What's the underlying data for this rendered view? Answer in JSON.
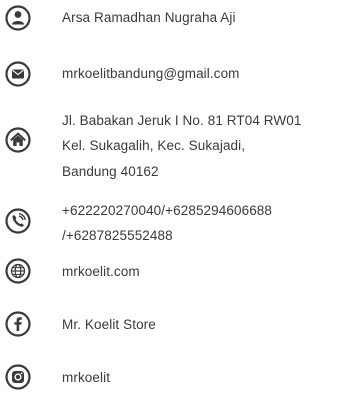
{
  "contacts": {
    "name": {
      "icon": "person-icon",
      "text": "Arsa Ramadhan Nugraha Aji"
    },
    "email": {
      "icon": "mail-icon",
      "text": "mrkoelitbandung@gmail.com"
    },
    "address": {
      "icon": "home-icon",
      "line1": "Jl. Babakan Jeruk I No. 81 RT04 RW01",
      "line2": "Kel. Sukagalih, Kec. Sukajadi,",
      "line3": "Bandung 40162"
    },
    "phone": {
      "icon": "phone-icon",
      "line1": "+622220270040/+6285294606688",
      "line2": "/+6287825552488"
    },
    "website": {
      "icon": "globe-icon",
      "text": "mrkoelit.com"
    },
    "facebook": {
      "icon": "facebook-icon",
      "text": "Mr. Koelit Store"
    },
    "instagram": {
      "icon": "instagram-icon",
      "text": "mrkoelit"
    }
  },
  "colors": {
    "icon": "#3a3a3a",
    "text": "#3a3a3a",
    "background": "#ffffff"
  }
}
